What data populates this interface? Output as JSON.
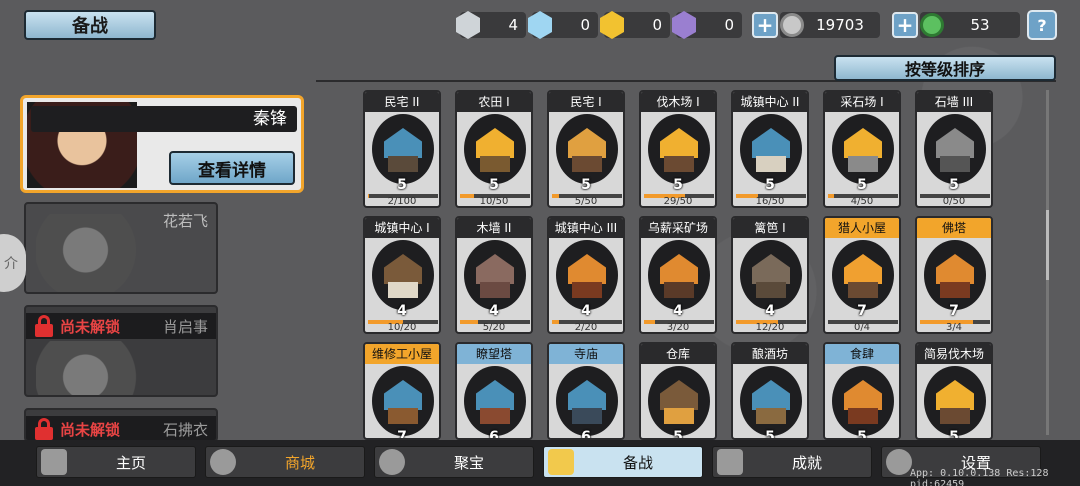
{
  "header": {
    "title": "备战",
    "resources": [
      {
        "icon": "silver-crest-icon",
        "value": "4",
        "color": "#cfd4d8"
      },
      {
        "icon": "ice-crest-icon",
        "value": "0",
        "color": "#9fd6f2"
      },
      {
        "icon": "gold-crest-icon",
        "value": "0",
        "color": "#f2c230"
      },
      {
        "icon": "purple-crest-icon",
        "value": "0",
        "color": "#9a7fd0"
      }
    ],
    "coins": "19703",
    "jade": "53",
    "help": "?"
  },
  "sort_button": "按等级排序",
  "heroes": [
    {
      "name": "秦锋",
      "detail": "查看详情"
    },
    {
      "name": "花若飞"
    },
    {
      "lock_text": "尚未解锁",
      "name": "肖启事"
    },
    {
      "lock_text": "尚未解锁",
      "name": "石拂衣"
    }
  ],
  "side_tab": "介",
  "buildings": [
    {
      "name": "民宅 II",
      "level": "5",
      "progress": "2/100",
      "ratio": 0.02,
      "header": "dark",
      "roof": "#4a90b8",
      "wall": "#5a4a3a"
    },
    {
      "name": "农田 I",
      "level": "5",
      "progress": "10/50",
      "ratio": 0.2,
      "header": "dark",
      "roof": "#f0b030",
      "wall": "#7a5a30"
    },
    {
      "name": "民宅 I",
      "level": "5",
      "progress": "5/50",
      "ratio": 0.1,
      "header": "dark",
      "roof": "#e0a040",
      "wall": "#6b4a32"
    },
    {
      "name": "伐木场 I",
      "level": "5",
      "progress": "29/50",
      "ratio": 0.58,
      "header": "dark",
      "roof": "#f0b030",
      "wall": "#6b4a32"
    },
    {
      "name": "城镇中心 II",
      "level": "5",
      "progress": "16/50",
      "ratio": 0.32,
      "header": "dark",
      "roof": "#4a90b8",
      "wall": "#d8d0c0"
    },
    {
      "name": "采石场 I",
      "level": "5",
      "progress": "4/50",
      "ratio": 0.08,
      "header": "dark",
      "roof": "#f0b030",
      "wall": "#8a8a8a"
    },
    {
      "name": "石墙 III",
      "level": "5",
      "progress": "0/50",
      "ratio": 0.0,
      "header": "dark",
      "roof": "#8a8a8a",
      "wall": "#555"
    },
    {
      "name": "城镇中心 I",
      "level": "4",
      "progress": "10/20",
      "ratio": 0.5,
      "header": "dark",
      "roof": "#7a5a3a",
      "wall": "#e0d8c8"
    },
    {
      "name": "木墙 II",
      "level": "4",
      "progress": "5/20",
      "ratio": 0.25,
      "header": "dark",
      "roof": "#8a6a60",
      "wall": "#6b4a42"
    },
    {
      "name": "城镇中心 III",
      "level": "4",
      "progress": "2/20",
      "ratio": 0.1,
      "header": "dark",
      "roof": "#e08a30",
      "wall": "#7a3a20"
    },
    {
      "name": "乌薪采矿场",
      "level": "4",
      "progress": "3/20",
      "ratio": 0.15,
      "header": "dark",
      "roof": "#e08a30",
      "wall": "#5a3a28"
    },
    {
      "name": "篱笆 I",
      "level": "4",
      "progress": "12/20",
      "ratio": 0.6,
      "header": "dark",
      "roof": "#7a6a5a",
      "wall": "#5a4a3a"
    },
    {
      "name": "猎人小屋",
      "level": "7",
      "progress": "0/4",
      "ratio": 0.0,
      "header": "gold",
      "roof": "#f0a030",
      "wall": "#6b4a32"
    },
    {
      "name": "佛塔",
      "level": "7",
      "progress": "3/4",
      "ratio": 0.75,
      "header": "gold",
      "roof": "#e08a30",
      "wall": "#7a3a20"
    },
    {
      "name": "维修工小屋",
      "level": "7",
      "progress": "",
      "ratio": 0.0,
      "header": "gold",
      "roof": "#4a90b8",
      "wall": "#8a5a30"
    },
    {
      "name": "瞭望塔",
      "level": "6",
      "progress": "",
      "ratio": 0.0,
      "header": "blue",
      "roof": "#4a90b8",
      "wall": "#8a4a30"
    },
    {
      "name": "寺庙",
      "level": "6",
      "progress": "",
      "ratio": 0.0,
      "header": "blue",
      "roof": "#4a90b8",
      "wall": "#3a4a5a"
    },
    {
      "name": "仓库",
      "level": "5",
      "progress": "",
      "ratio": 0.0,
      "header": "dark",
      "roof": "#7a5a3a",
      "wall": "#e0a040"
    },
    {
      "name": "酿酒坊",
      "level": "5",
      "progress": "",
      "ratio": 0.0,
      "header": "dark",
      "roof": "#4a90b8",
      "wall": "#8a6a40"
    },
    {
      "name": "食肆",
      "level": "5",
      "progress": "",
      "ratio": 0.0,
      "header": "blue",
      "roof": "#e08a30",
      "wall": "#7a3a20"
    },
    {
      "name": "简易伐木场",
      "level": "5",
      "progress": "",
      "ratio": 0.0,
      "header": "dark",
      "roof": "#f0b030",
      "wall": "#6b4a32"
    }
  ],
  "nav": [
    {
      "label": "主页",
      "icon": "home-icon"
    },
    {
      "label": "商城",
      "icon": "coins-icon"
    },
    {
      "label": "聚宝",
      "icon": "treasure-bowl-icon"
    },
    {
      "label": "备战",
      "icon": "flag-icon"
    },
    {
      "label": "成就",
      "icon": "achievement-icon"
    },
    {
      "label": "设置",
      "icon": "gear-icon"
    }
  ],
  "debug": "App: 0.10.0.138 Res:128 pid:62459"
}
